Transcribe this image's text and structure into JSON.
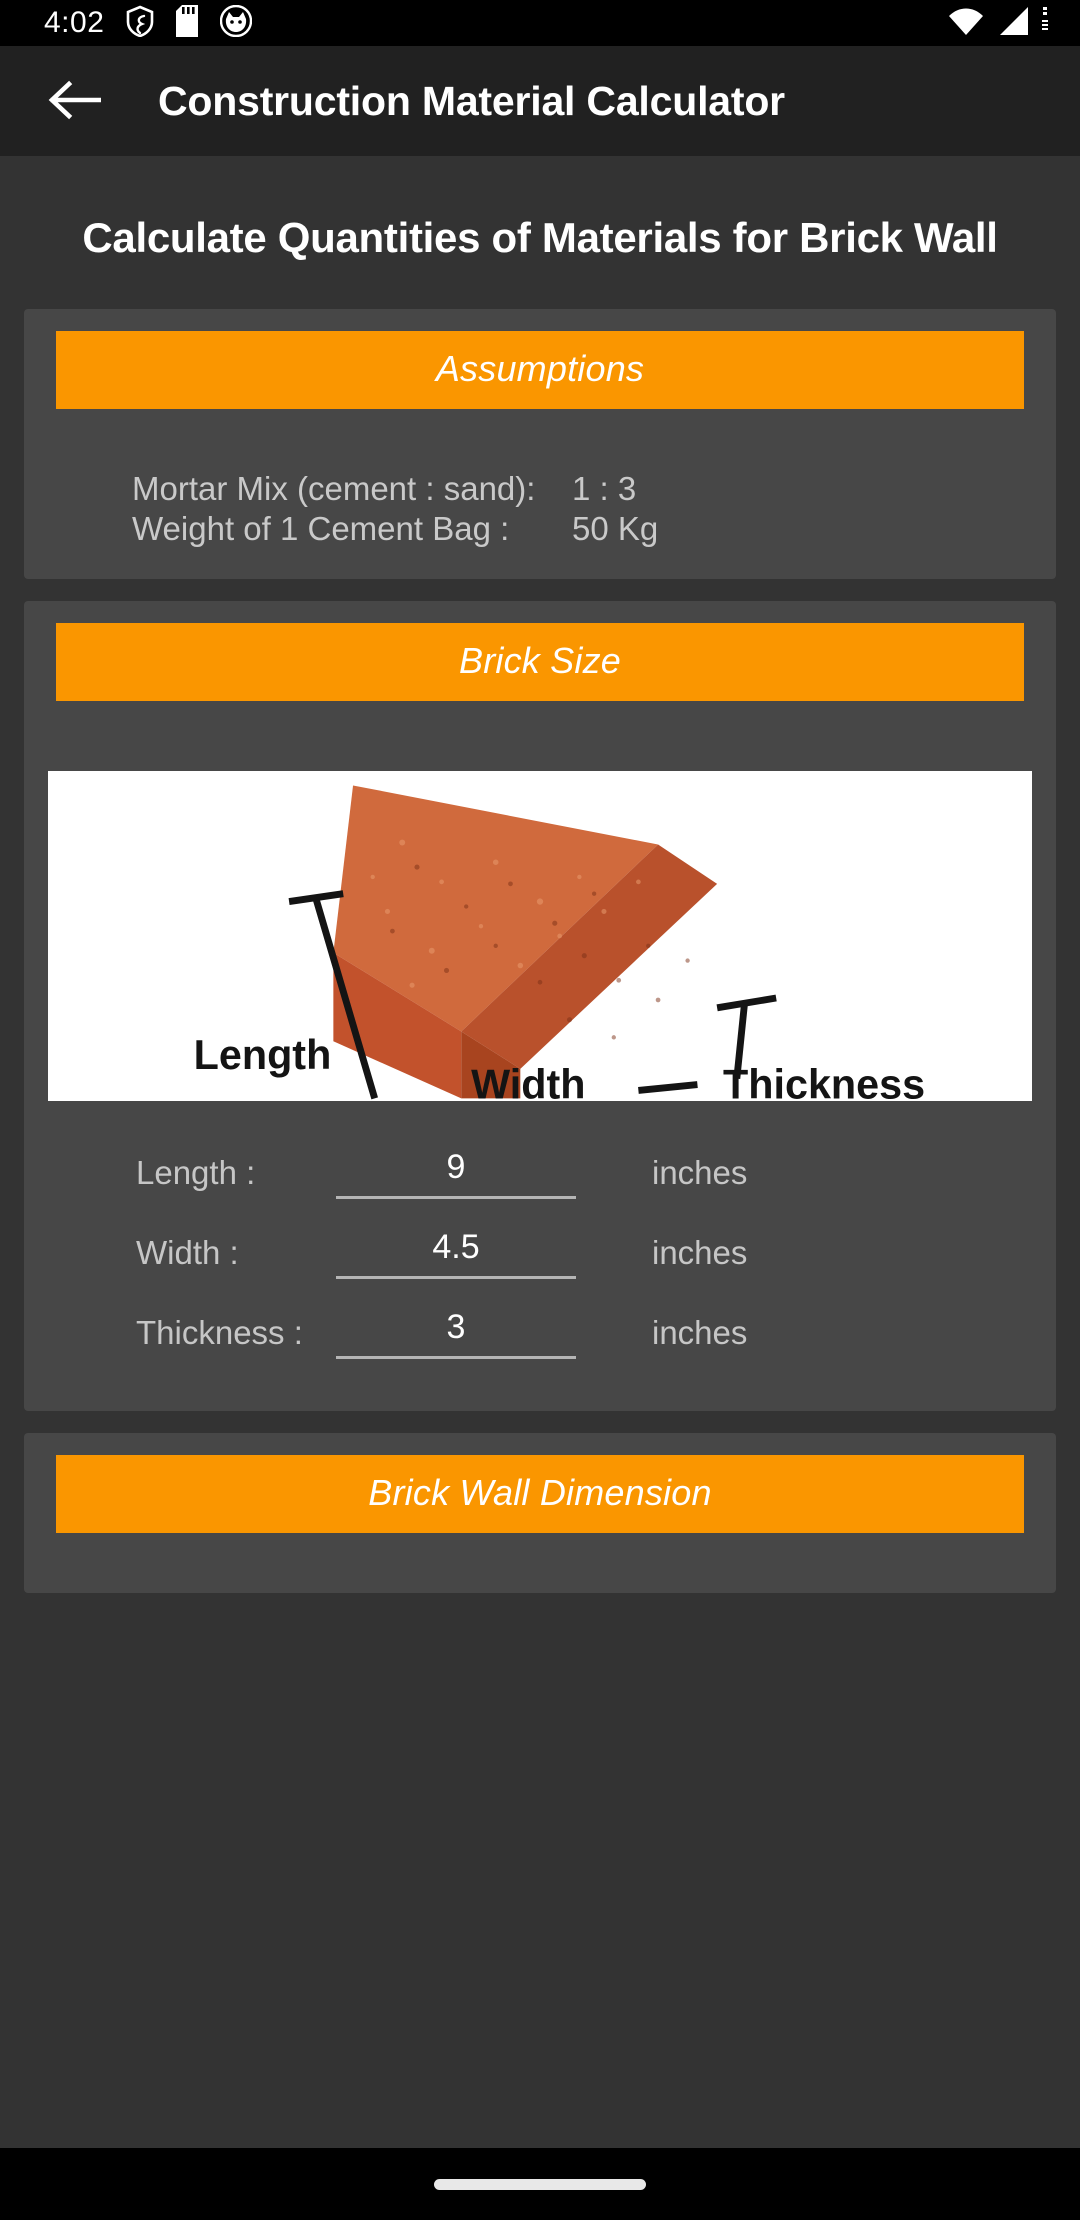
{
  "status_bar": {
    "time": "4:02",
    "left_icons": [
      "shield-icon",
      "sd-card-icon",
      "cat-avatar-icon"
    ],
    "right_icons": [
      "wifi-icon",
      "cellular-signal-icon",
      "battery-icon"
    ]
  },
  "app_bar": {
    "back_icon": "back-arrow-icon",
    "title": "Construction Material Calculator"
  },
  "page": {
    "heading": "Calculate Quantities of Materials for Brick Wall"
  },
  "assumptions": {
    "header": "Assumptions",
    "rows": [
      {
        "label": "Mortar Mix (cement : sand):",
        "value": "1 : 3"
      },
      {
        "label": "Weight of 1 Cement Bag :",
        "value": "50 Kg"
      }
    ]
  },
  "brick_size": {
    "header": "Brick Size",
    "image": {
      "name": "brick-dimensions-diagram",
      "labels": {
        "length": "Length",
        "thickness": "Thickness",
        "width": "Width"
      }
    },
    "fields": [
      {
        "label": "Length :",
        "value": "9",
        "unit": "inches"
      },
      {
        "label": "Width :",
        "value": "4.5",
        "unit": "inches"
      },
      {
        "label": "Thickness :",
        "value": "3",
        "unit": "inches"
      }
    ]
  },
  "brick_wall_dimension": {
    "header": "Brick Wall Dimension"
  },
  "colors": {
    "accent_orange": "#fa9600",
    "page_background": "#333333",
    "card_background": "#474747",
    "app_bar": "#212121",
    "status_bar": "#000000",
    "label_text": "#c6c6c6",
    "value_text": "#ffffff"
  },
  "nav_bar": {
    "pill": "gesture-home-pill"
  }
}
